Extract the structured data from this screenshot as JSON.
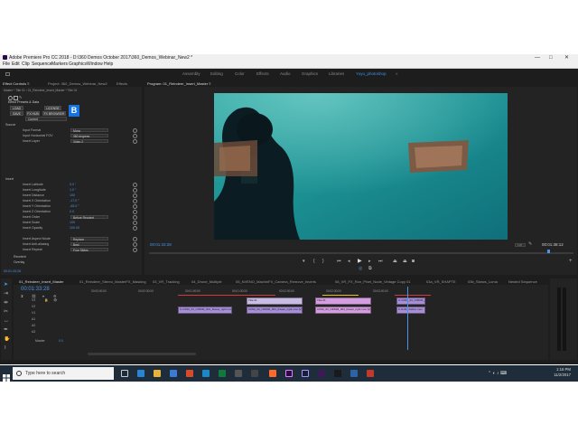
{
  "window": {
    "title": "Adobe Premiere Pro CC 2018 - D:\\360 Demos October 2017\\360_Demos_Webinar_New2 *",
    "controls": [
      "—",
      "□",
      "✕"
    ]
  },
  "menu": [
    "File",
    "Edit",
    "Clip",
    "Sequence",
    "Markers",
    "Graphics",
    "Window",
    "Help"
  ],
  "workspaces": {
    "items": [
      "Assembly",
      "Editing",
      "Color",
      "Effects",
      "Audio",
      "Graphics",
      "Libraries",
      "Yuyu_photoshop"
    ],
    "active_index": 7,
    "more": "»"
  },
  "fx_panel": {
    "tabs": [
      "Effect Controls ≡",
      "Project: 360_Demos_Webinar_New2",
      "Effects"
    ],
    "source_path": "Master * Title 01 › 01_Reindeer_Insert_Master * Title 01",
    "section_label": "Effect Presets & Data",
    "buttons": {
      "load": "LOAD",
      "license": "LICENSE",
      "save": "SAVE",
      "fx_hub": "FX HUB",
      "fx_browser": "FX BROWSER",
      "current": "Current"
    },
    "group_source": "Source",
    "group_insert": "Insert",
    "rows": [
      {
        "label": "Input Format",
        "value": "Mono"
      },
      {
        "label": "Input Horizontal FOV",
        "value": "360 degrees"
      },
      {
        "label": "Insert Layer",
        "value": "Video 2"
      },
      {
        "label": "Insert Latitude",
        "value": "0.0 °"
      },
      {
        "label": "Insert Longitude",
        "value": "1.0 °"
      },
      {
        "label": "Insert Distance",
        "value": "100"
      },
      {
        "label": "Insert X Orientation",
        "value": "-17.0 °"
      },
      {
        "label": "Insert Y Orientation",
        "value": "-45.0 °"
      },
      {
        "label": "Insert Z Orientation",
        "value": "0.0"
      },
      {
        "label": "Insert Order",
        "value": "Before Reorient"
      },
      {
        "label": "Insert Scale",
        "value": "100"
      },
      {
        "label": "Insert Opacity",
        "value": "100.00"
      },
      {
        "label": "Insert Aspect Mode",
        "value": "Replace"
      },
      {
        "label": "Insert Anti-aliasing",
        "value": "Best"
      },
      {
        "label": "Insert Repeat",
        "value": "Four Slides"
      }
    ],
    "groups_after": [
      "Reorient",
      "Overlay"
    ],
    "timecode": "00:01:33:28"
  },
  "program": {
    "tab": "Program: 01_Reindeer_Insert_Master ≡",
    "timecode_left": "00:01:33:28",
    "timecode_right": "00:01:38:12",
    "zoom": "1/2"
  },
  "timeline": {
    "tabs": [
      "01_Reindeer_Insert_Master",
      "01_Reindeer_Stereo_MasterFX_Masking",
      "03_VR_Tracking",
      "04_Drone_Multiple",
      "05_NVENO_MachinFX_Camera_Remove_Inverts",
      "06_VR_FX_Ron_Pixel_Node_Vintage Copy 01",
      "03a_VR_SHAPTE",
      "03b_Skews_Luma",
      "Nested Sequence"
    ],
    "timecode": "00:01:33:28",
    "ruler": [
      "00:00:00:00",
      "00:00:30:00",
      "00:01:00:00",
      "00:01:30:00",
      "00:02:00:00",
      "00:02:30:00",
      "00:03:00:00"
    ],
    "tracks": [
      "V3",
      "V2",
      "V1",
      "A1",
      "A2",
      "A3"
    ],
    "master_label": "Master",
    "master_value": "0.0",
    "clips": [
      {
        "label": "fx  C0N0_03_O350M_004_Rowei_right.mov"
      },
      {
        "label": "Title 01"
      },
      {
        "label": "C0N0_03_O350M_004_Rowei_right.mov [V]"
      },
      {
        "label": "Title 01"
      },
      {
        "label": "C0N0_03_O350M_004_Rowei_right.mov [V]"
      },
      {
        "label": "fx  C0N0_03_O350M_"
      },
      {
        "label": "fx  Dolby Reflex.mov"
      }
    ]
  },
  "taskbar": {
    "search_placeholder": "Type here to search",
    "time": "1:16 PM",
    "date": "11/2/2017"
  }
}
